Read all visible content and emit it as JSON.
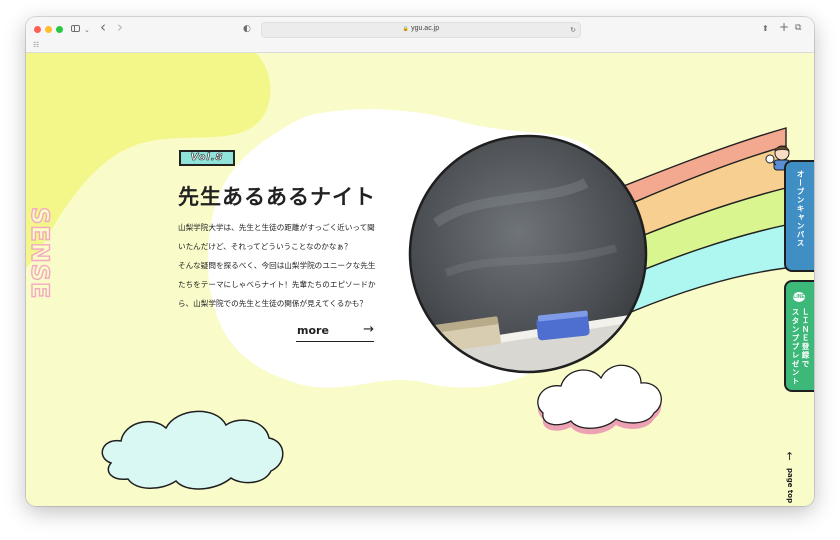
{
  "browser": {
    "url": "ygu.ac.jp",
    "icons": {
      "sidebar": "sidebar-icon",
      "back": "‹",
      "forward": "›",
      "privacy": "◐",
      "reload": "↻",
      "share": "⬆",
      "new_tab": "+",
      "tabs": "⧉",
      "extensions": "☷"
    }
  },
  "hero": {
    "vol_label": "Vol.8",
    "title": "先生あるあるナイト",
    "description": [
      "山梨学院大学は、先生と生徒の距離がすっごく近いって聞",
      "いたんだけど、それってどういうことなのかなぁ？",
      "そんな疑問を探るべく、今回は山梨学院のユニークな先生",
      "たちをテーマにしゃべらナイト！先輩たちのエピソードか",
      "ら、山梨学院での先生と生徒の関係が見えてくるかも？"
    ],
    "more_label": "more",
    "more_arrow": "→",
    "sensei_text": "SENSEI"
  },
  "side_tabs": {
    "open_campus": "オープンキャンパス",
    "line_icon": "LINE",
    "line_label": "ＬＩＮＥ登録で\nスタンププレゼント"
  },
  "page_top": {
    "arrow": "↑",
    "label": "page top"
  },
  "colors": {
    "page_bg": "#f9fbc9",
    "blob_yellow": "#f3f78a",
    "rainbow": [
      "#f2a98f",
      "#f7cf91",
      "#d9f590",
      "#aef6f0"
    ],
    "vol_tag": "#8fe3d8",
    "open_campus_tab": "#3f8fc4",
    "line_tab": "#3cb878",
    "cloud_blue": "#d9f8f4",
    "cloud_pink_shadow": "#eda2b4",
    "sensei_outline": "#f3a9c1"
  }
}
